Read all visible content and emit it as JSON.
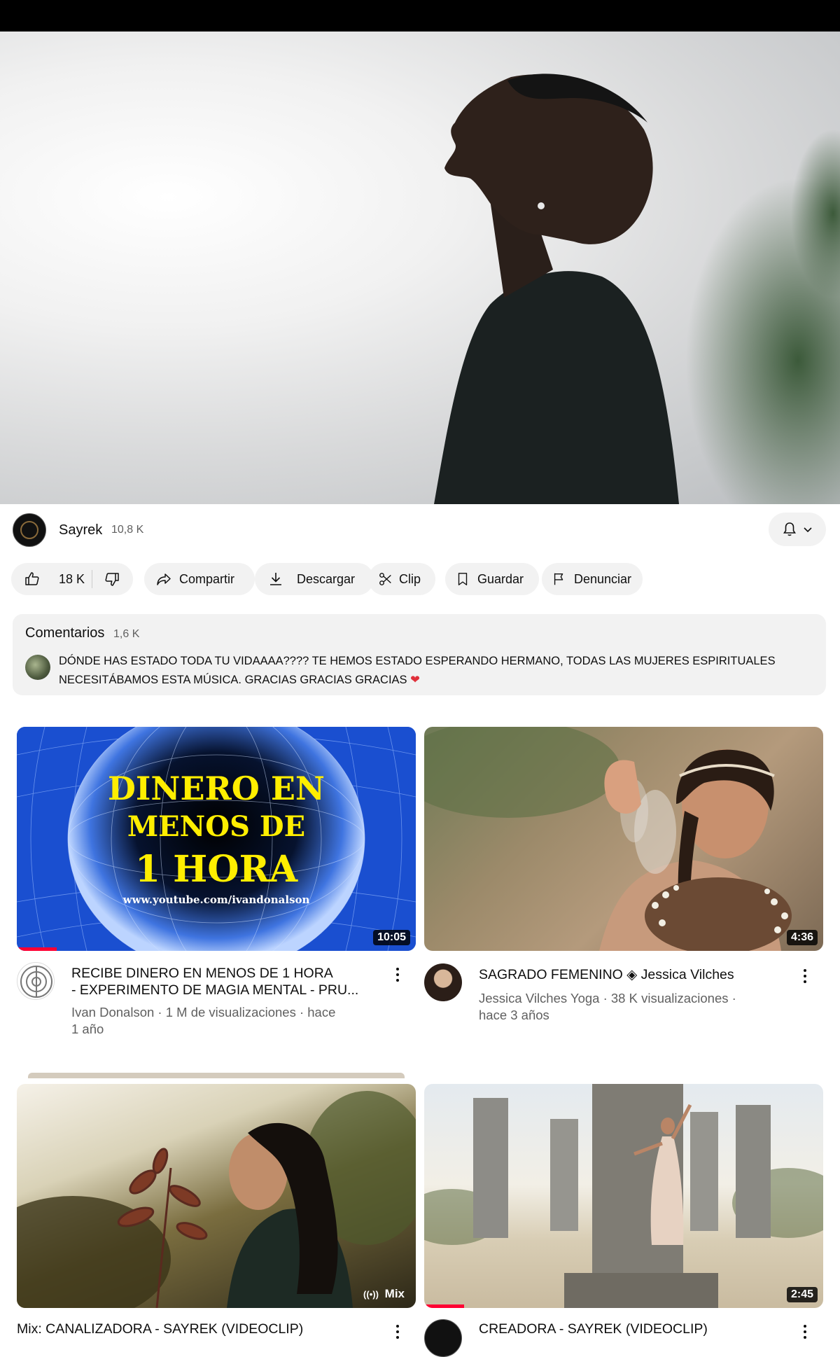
{
  "player": {
    "description_icon": "video-frame"
  },
  "channel": {
    "name": "Sayrek",
    "subscribers": "10,8 K"
  },
  "actions": {
    "likes": "18 K",
    "share": "Compartir",
    "download": "Descargar",
    "clip": "Clip",
    "save": "Guardar",
    "report": "Denunciar"
  },
  "comments": {
    "title": "Comentarios",
    "count": "1,6 K",
    "top_comment": "DÓNDE HAS ESTADO TODA TU VIDAAAA???? TE HEMOS ESTADO ESPERANDO HERMANO, TODAS LAS MUJERES ESPIRITUALES NECESITÁBAMOS ESTA MÚSICA.  GRACIAS GRACIAS GRACIAS",
    "heart": "❤"
  },
  "videos": [
    {
      "thumb_line1": "DINERO EN",
      "thumb_line2": "MENOS DE",
      "thumb_line3": "1 HORA",
      "thumb_url": "www.youtube.com/ivandonalson",
      "duration": "10:05",
      "title_line1": "RECIBE DINERO EN MENOS DE 1 HORA",
      "title_line2": "- EXPERIMENTO DE MAGIA MENTAL - PRU...",
      "meta_line1": "Ivan Donalson · 1 M de visualizaciones · hace",
      "meta_line2": "1 año",
      "progress_fraction": 0.1
    },
    {
      "duration": "4:36",
      "title_line1": "SAGRADO FEMENINO ◈ Jessica Vilches",
      "meta_line1": "Jessica Vilches Yoga · 38 K visualizaciones ·",
      "meta_line2": "hace 3 años"
    },
    {
      "badge": "Mix",
      "title_line1": "Mix: CANALIZADORA - SAYREK (VIDEOCLIP)"
    },
    {
      "duration": "2:45",
      "title_line1": "CREADORA - SAYREK (VIDEOCLIP)",
      "progress_fraction": 0.1
    }
  ]
}
